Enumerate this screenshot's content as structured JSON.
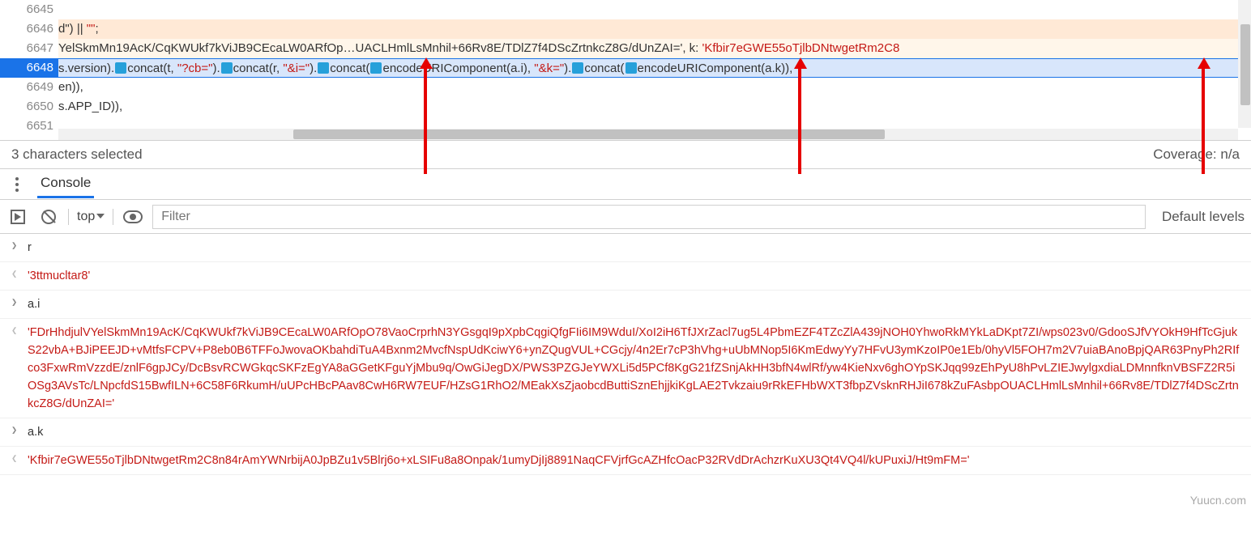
{
  "source": {
    "line_numbers": [
      "6645",
      "6646",
      "6647",
      "6648",
      "6649",
      "6650",
      "6651"
    ],
    "l6646": {
      "a": "d\") || ",
      "b": "\"\"",
      "c": ";"
    },
    "l6647": {
      "a": "YelSkmMn19AcK/CqKWUkf7kViJB9CEcaLW0ARfOp…UACLHmlLsMnhil+66Rv8E/TDlZ7f4DScZrtnkcZ8G/dUnZAI='",
      "b": ", k: ",
      "c": "'Kfbir7eGWE55oTjlbDNtwgetRm2C8"
    },
    "l6648": [
      {
        "t": "prop",
        "v": "s.version)."
      },
      {
        "t": "ico"
      },
      {
        "t": "fn",
        "v": "concat"
      },
      {
        "t": "prop",
        "v": "(t, "
      },
      {
        "t": "str",
        "v": "\"?cb=\""
      },
      {
        "t": "prop",
        "v": ")."
      },
      {
        "t": "ico"
      },
      {
        "t": "fn",
        "v": "concat"
      },
      {
        "t": "prop",
        "v": "(r, "
      },
      {
        "t": "str",
        "v": "\"&i=\""
      },
      {
        "t": "prop",
        "v": ")."
      },
      {
        "t": "ico"
      },
      {
        "t": "fn",
        "v": "concat"
      },
      {
        "t": "prop",
        "v": "("
      },
      {
        "t": "ico"
      },
      {
        "t": "fn",
        "v": "encodeURIComponent"
      },
      {
        "t": "prop",
        "v": "(a.i), "
      },
      {
        "t": "str",
        "v": "\"&k=\""
      },
      {
        "t": "prop",
        "v": ")."
      },
      {
        "t": "ico"
      },
      {
        "t": "fn",
        "v": "concat"
      },
      {
        "t": "prop",
        "v": "("
      },
      {
        "t": "ico"
      },
      {
        "t": "fn",
        "v": "encodeURIComponent"
      },
      {
        "t": "prop",
        "v": "(a.k)),"
      }
    ],
    "l6649": "en)),",
    "l6650": "s.APP_ID)),",
    "l6651": ""
  },
  "status": {
    "left": "3 characters selected",
    "right": "Coverage: n/a"
  },
  "tabs": {
    "active": "Console"
  },
  "toolbar": {
    "context": "top",
    "filter_ph": "Filter",
    "right": "Default levels"
  },
  "console": [
    {
      "dir": "in",
      "v": "r"
    },
    {
      "dir": "out",
      "v": "'3ttmucltar8'"
    },
    {
      "dir": "in",
      "v": "a.i"
    },
    {
      "dir": "out",
      "v": "'FDrHhdjulVYelSkmMn19AcK/CqKWUkf7kViJB9CEcaLW0ARfOpO78VaoCrprhN3YGsgqI9pXpbCqgiQfgFIi6IM9WduI/XoI2iH6TfJXrZacl7ug5L4PbmEZF4TZcZlA439jNOH0YhwoRkMYkLaDKpt7ZI/wps023v0/GdooSJfVYOkH9HfTcGjukS22vbA+BJiPEEJD+vMtfsFCPV+P8eb0B6TFFoJwovaOKbahdiTuA4Bxnm2MvcfNspUdKciwY6+ynZQugVUL+CGcjy/4n2Er7cP3hVhg+uUbMNop5I6KmEdwyYy7HFvU3ymKzoIP0e1Eb/0hyVl5FOH7m2V7uiaBAnoBpjQAR63PnyPh2RIfco3FxwRmVzzdE/znlF6gpJCy/DcBsvRCWGkqcSKFzEgYA8aGGetKFguYjMbu9q/OwGiJegDX/PWS3PZGJeYWXLi5d5PCf8KgG21fZSnjAkHH3bfN4wlRf/yw4KieNxv6ghOYpSKJqq99zEhPyU8hPvLZIEJwylgxdiaLDMnnfknVBSFZ2R5iOSg3AVsTc/LNpcfdS15BwfILN+6C58F6RkumH/uUPcHBcPAav8CwH6RW7EUF/HZsG1RhO2/MEakXsZjaobcdButtiSznEhjjkiKgLAE2Tvkzaiu9rRkEFHbWXT3fbpZVsknRHJiI678kZuFAsbpOUACLHmlLsMnhil+66Rv8E/TDlZ7f4DScZrtnkcZ8G/dUnZAI='"
    },
    {
      "dir": "in",
      "v": "a.k"
    },
    {
      "dir": "out",
      "v": "'Kfbir7eGWE55oTjlbDNtwgetRm2C8n84rAmYWNrbijA0JpBZu1v5Blrj6o+xLSIFu8a8Onpak/1umyDjIj8891NaqCFVjrfGcAZHfcOacP32RVdDrAchzrKuXU3Qt4VQ4l/kUPuxiJ/Ht9mFM='"
    }
  ],
  "watermark": "Yuucn.com"
}
